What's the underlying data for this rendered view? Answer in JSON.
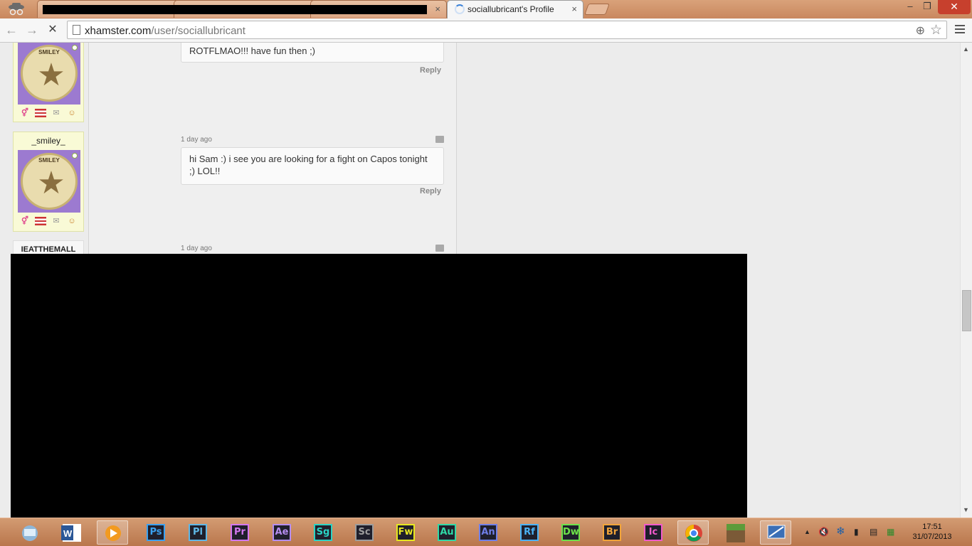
{
  "browser": {
    "tabs": [
      {
        "label": "",
        "redacted": true
      },
      {
        "label": "",
        "redacted": true
      },
      {
        "label": "",
        "redacted": true
      },
      {
        "label": "sociallubricant's Profile",
        "active": true,
        "loading": true
      }
    ],
    "tab_close_glyph": "×",
    "window_controls": {
      "minimize": "–",
      "restore": "❐",
      "close": "✕"
    },
    "url": {
      "domain": "xhamster.com",
      "path": "/user/sociallubricant"
    }
  },
  "comments": [
    {
      "username": "_smiley_",
      "timestamp": "",
      "text": "ROTFLMAO!!! have fun then ;)",
      "reply_label": "Reply",
      "badge_text": "SMILEY"
    },
    {
      "username": "_smiley_",
      "timestamp": "1 day ago",
      "text": "hi Sam :) i see you are looking for a fight on Capos tonight ;) LOL!!",
      "reply_label": "Reply",
      "badge_text": "SMILEY"
    },
    {
      "username": "IEATTHEMALL",
      "timestamp": "1 day ago"
    }
  ],
  "taskbar": {
    "adobe_apps": [
      {
        "abbr": "Ps",
        "color": "#3aa1f0"
      },
      {
        "abbr": "Pl",
        "color": "#5fb7e6"
      },
      {
        "abbr": "Pr",
        "color": "#d277f0"
      },
      {
        "abbr": "Ae",
        "color": "#b58df0"
      },
      {
        "abbr": "Sg",
        "color": "#2bd3c4"
      },
      {
        "abbr": "Sc",
        "color": "#9d9d9d"
      },
      {
        "abbr": "Fw",
        "color": "#e6e820"
      },
      {
        "abbr": "Au",
        "color": "#2fd9a7"
      },
      {
        "abbr": "An",
        "color": "#6f7fe8"
      },
      {
        "abbr": "Rf",
        "color": "#4ab2f5"
      },
      {
        "abbr": "Dw",
        "color": "#6de24a"
      },
      {
        "abbr": "Br",
        "color": "#f1a43a"
      },
      {
        "abbr": "Ic",
        "color": "#f25acb"
      }
    ],
    "clock": {
      "time": "17:51",
      "date": "31/07/2013"
    }
  }
}
